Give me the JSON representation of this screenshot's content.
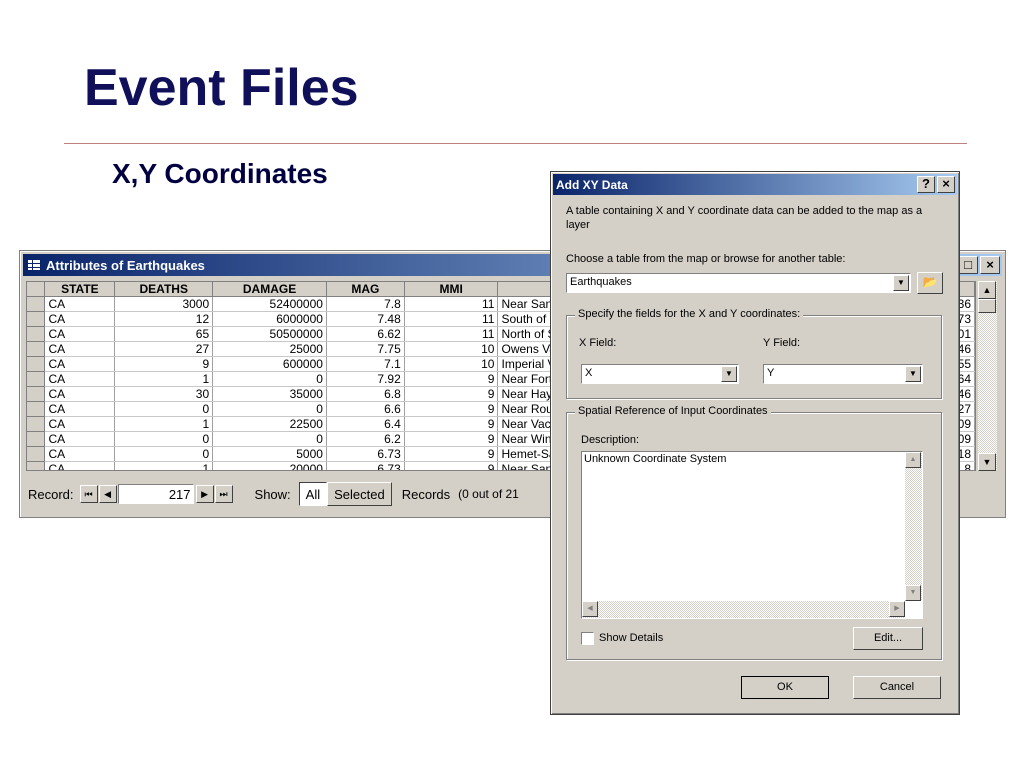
{
  "slide": {
    "title": "Event Files",
    "subtitle": "X,Y Coordinates"
  },
  "attributes_window": {
    "title": "Attributes of Earthquakes",
    "columns": [
      "STATE",
      "DEATHS",
      "DAMAGE",
      "MAG",
      "MMI",
      ""
    ],
    "rows": [
      [
        "CA",
        "3000",
        "52400000",
        "7.8",
        "11",
        "Near San"
      ],
      [
        "CA",
        "12",
        "6000000",
        "7.48",
        "11",
        "South of E"
      ],
      [
        "CA",
        "65",
        "50500000",
        "6.62",
        "11",
        "North of S"
      ],
      [
        "CA",
        "27",
        "25000",
        "7.75",
        "10",
        "Owens Va"
      ],
      [
        "CA",
        "9",
        "600000",
        "7.1",
        "10",
        "Imperial V"
      ],
      [
        "CA",
        "1",
        "0",
        "7.92",
        "9",
        "Near Fort"
      ],
      [
        "CA",
        "30",
        "35000",
        "6.8",
        "9",
        "Near Hay"
      ],
      [
        "CA",
        "0",
        "0",
        "6.6",
        "9",
        "Near Rou"
      ],
      [
        "CA",
        "1",
        "22500",
        "6.4",
        "9",
        "Near Vac"
      ],
      [
        "CA",
        "0",
        "0",
        "6.2",
        "9",
        "Near Wint"
      ],
      [
        "CA",
        "0",
        "5000",
        "6.73",
        "9",
        "Hemet-Sa"
      ],
      [
        "CA",
        "1",
        "20000",
        "6.73",
        "9",
        "Near San"
      ]
    ],
    "right_edge_cells": [
      "36",
      "73",
      "01",
      "46",
      "55",
      "64",
      "46",
      "27",
      "09",
      "09",
      "18",
      "8"
    ],
    "record_label": "Record:",
    "record_value": "217",
    "show_label": "Show:",
    "show_all": "All",
    "show_selected": "Selected",
    "records_label": "Records",
    "records_count": "(0 out of 21"
  },
  "dialog": {
    "title": "Add XY Data",
    "help_button": "?",
    "close_button": "×",
    "intro_text": "A table containing X and Y coordinate data can be added to the map as a layer",
    "choose_label": "Choose a table from the map or browse for another table:",
    "table_value": "Earthquakes",
    "fields_group": "Specify the fields for the X and Y coordinates:",
    "x_field_label": "X Field:",
    "x_field_value": "X",
    "y_field_label": "Y Field:",
    "y_field_value": "Y",
    "spatial_group": "Spatial Reference of Input Coordinates",
    "description_label": "Description:",
    "description_value": "Unknown Coordinate System",
    "show_details": "Show Details",
    "edit_button": "Edit...",
    "ok_button": "OK",
    "cancel_button": "Cancel"
  },
  "colors": {
    "title_text": "#10105a",
    "titlebar_start": "#0a246a",
    "titlebar_end": "#a6caf0",
    "window_face": "#d4d0c8",
    "rule": "#c08080"
  }
}
